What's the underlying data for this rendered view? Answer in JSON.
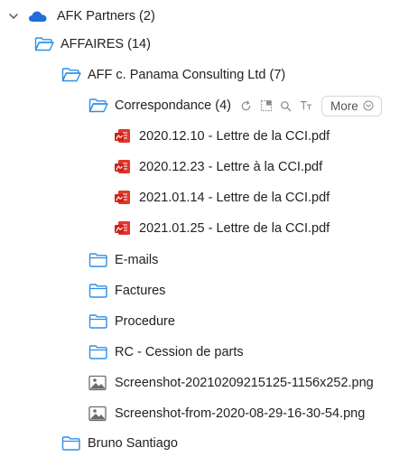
{
  "tree": {
    "root": {
      "label": "AFK Partners (2)"
    },
    "affaires": {
      "label": "AFFAIRES (14)"
    },
    "case": {
      "label": "AFF c. Panama Consulting Ltd (7)"
    },
    "correspondance": {
      "label": "Correspondance (4)",
      "actions": {
        "more_label": "More"
      }
    },
    "files": [
      {
        "label": "2020.12.10 - Lettre de la CCI.pdf"
      },
      {
        "label": "2020.12.23 - Lettre à la CCI.pdf"
      },
      {
        "label": "2021.01.14 - Lettre de la CCI.pdf"
      },
      {
        "label": "2021.01.25 - Lettre de la CCI.pdf"
      }
    ],
    "folders": [
      {
        "label": "E-mails"
      },
      {
        "label": "Factures"
      },
      {
        "label": "Procedure"
      },
      {
        "label": "RC - Cession de parts"
      }
    ],
    "images": [
      {
        "label": "Screenshot-20210209215125-1156x252.png"
      },
      {
        "label": "Screenshot-from-2020-08-29-16-30-54.png"
      }
    ],
    "bottom": {
      "label": "Bruno Santiago"
    }
  },
  "colors": {
    "folder_blue": "#2f8fe6",
    "cloud_blue": "#1f6fd6",
    "pdf_red": "#e2352a",
    "text": "#222222",
    "muted": "#8a8a8a"
  },
  "icons": {
    "root": "chevron-down-icon",
    "cloud": "onedrive-cloud-icon",
    "open_folder": "folder-open-icon",
    "closed_folder": "folder-icon",
    "pdf": "pdf-file-icon",
    "image": "image-file-icon",
    "refresh": "refresh-icon",
    "select": "select-all-icon",
    "search": "search-icon",
    "text": "text-size-icon",
    "more_chevron": "chevron-down-circle-icon"
  }
}
